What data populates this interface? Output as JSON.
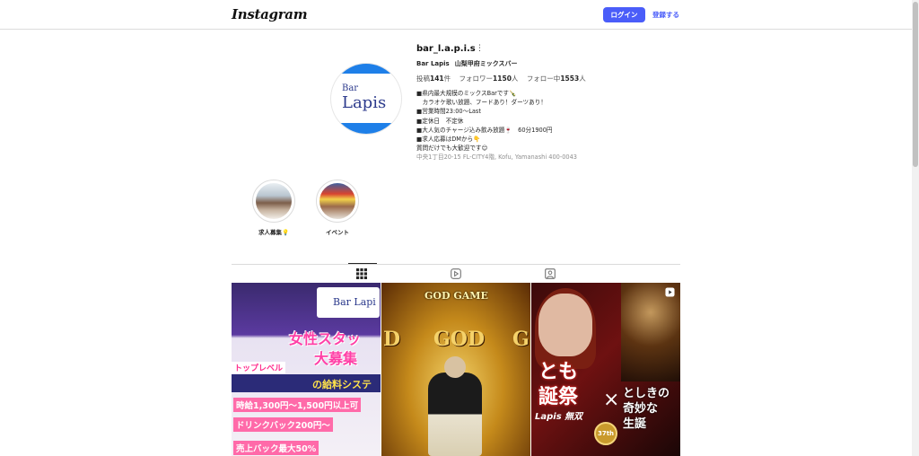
{
  "header": {
    "logo": "Instagram",
    "login_label": "ログイン",
    "signup_label": "登録する"
  },
  "profile": {
    "avatar": {
      "line1": "Bar",
      "line2": "Lapis"
    },
    "username": "bar_l.a.p.i.s",
    "fullname": "Bar Lapis",
    "category": "山梨甲府ミックスバー",
    "stats": {
      "posts_label": "投稿",
      "posts": "141",
      "posts_unit": "件",
      "followers_label": "フォロワー",
      "followers": "1150",
      "followers_unit": "人",
      "following_label": "フォロー中",
      "following": "1553",
      "following_unit": "人"
    },
    "bio_lines": [
      "■県内最大規模のミックスBarです🍾",
      "　カラオケ歌い放題、フードあり！ダーツあり！",
      "■営業時間23:00〜Last",
      "■定休日　不定休",
      "■大人気のチャージ込み飲み放題🍷　60分1900円",
      "■求人応募はDMから👇",
      "質問だけでも大歓迎です😊"
    ],
    "address": "中央1丁目20-15 FL-CITY4階, Kofu, Yamanashi 400-0043"
  },
  "highlights": [
    {
      "label": "求人募集💡"
    },
    {
      "label": "イベント"
    }
  ],
  "tabs": [
    {
      "icon": "grid-icon",
      "active": true
    },
    {
      "icon": "reels-icon",
      "active": false
    },
    {
      "icon": "tagged-icon",
      "active": false
    }
  ],
  "posts": {
    "p1": {
      "logo_text": "Bar Lapi",
      "head1": "女性スタッ",
      "head2": "大募集",
      "band": "の給料システ",
      "tag": "トップレベル",
      "line1": "時給1,300円〜1,500円以上可",
      "line2": "ドリンクバック200円〜",
      "line3": "売上バック最大50%",
      "icon": "pin-icon"
    },
    "p2": {
      "title": "GOD GAME",
      "god_left": "D",
      "god_center": "GOD",
      "god_right": "G"
    },
    "p3": {
      "text1": "とも",
      "text2": "誕祭",
      "x": "×",
      "right1": "としきの",
      "right2": "奇妙な",
      "right3": "生誕",
      "lapis": "Lapis 無双",
      "badge": "37th",
      "icon": "reel-icon"
    }
  }
}
